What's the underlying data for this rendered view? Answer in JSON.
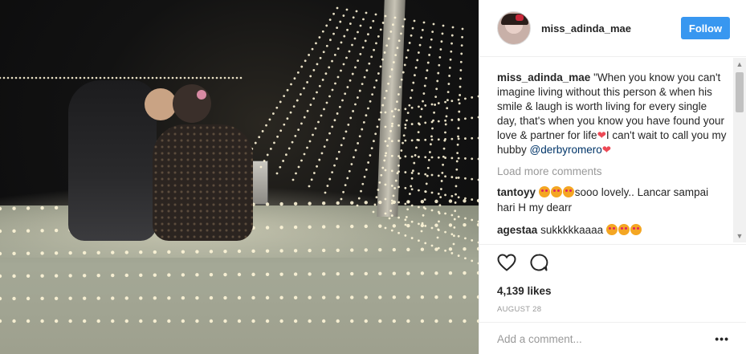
{
  "post": {
    "username": "miss_adinda_mae",
    "follow_label": "Follow",
    "caption_user": "miss_adinda_mae",
    "caption_text": " \"When you know you can't imagine living without this person & when his smile & laugh is worth living for every single day, that's when you know you have found your love & partner for life",
    "caption_heart": "❤",
    "caption_text2": "I can't wait to call you my hubby ",
    "caption_mention": "@derbyromero",
    "caption_heart2": "❤",
    "load_more": "Load more comments",
    "comments": [
      {
        "user": "tantoyy",
        "emoji_count": 3,
        "text": "sooo lovely.. Lancar sampai hari H my dearr"
      },
      {
        "user": "agestaa",
        "emoji_count": 3,
        "text": "sukkkkkaaaa "
      }
    ],
    "likes": "4,139 likes",
    "date": "AUGUST 28",
    "add_comment_placeholder": "Add a comment...",
    "more_label": "•••"
  },
  "icons": {
    "like": "heart-outline-icon",
    "comment": "comment-bubble-icon",
    "scroll_up": "▲",
    "scroll_down": "▼"
  },
  "colors": {
    "accent": "#3897f0",
    "mention": "#003569",
    "muted": "#999999",
    "heart": "#ed4956"
  }
}
